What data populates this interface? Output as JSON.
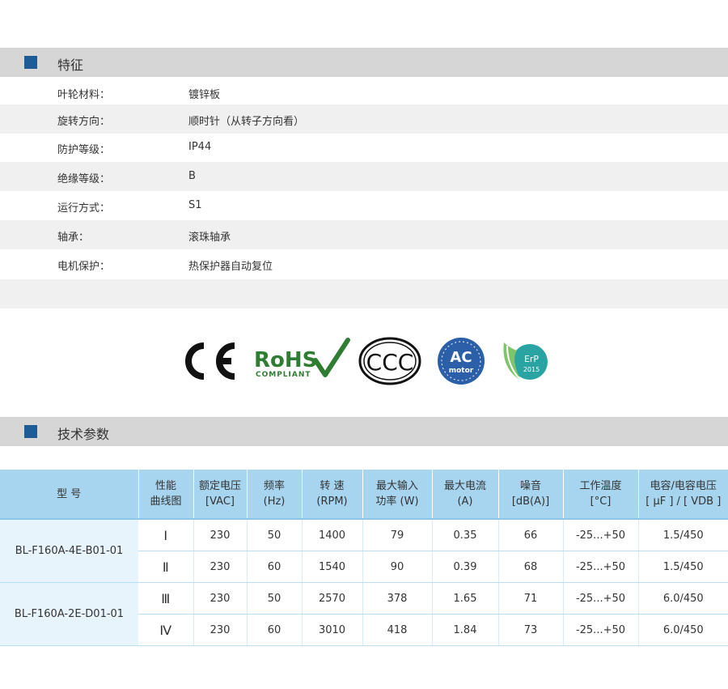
{
  "features": {
    "title": "特征",
    "rows": [
      {
        "label": "叶轮材料：",
        "value": "镀锌板"
      },
      {
        "label": "旋转方向：",
        "value": "顺时针（从转子方向看）"
      },
      {
        "label": "防护等级：",
        "value": "IP44"
      },
      {
        "label": "绝缘等级：",
        "value": "B"
      },
      {
        "label": "运行方式：",
        "value": "S1"
      },
      {
        "label": "轴承：",
        "value": "滚珠轴承"
      },
      {
        "label": "电机保护：",
        "value": "热保护器自动复位"
      }
    ]
  },
  "certifications": {
    "ce": "CE",
    "rohs_main": "RoHS",
    "rohs_sub": "COMPLIANT",
    "ccc": "CCC",
    "ac_main": "AC",
    "ac_sub": "motor",
    "erp_main": "ErP",
    "erp_year": "2015",
    "colors": {
      "rohs_green": "#2e7d32",
      "ac_blue": "#2b5fa8",
      "erp_teal": "#2aa3a3"
    }
  },
  "specs": {
    "title": "技术参数",
    "headers": [
      [
        "型 号"
      ],
      [
        "性能",
        "曲线图"
      ],
      [
        "额定电压",
        "[VAC]"
      ],
      [
        "频率",
        "(Hz)"
      ],
      [
        "转 速",
        "(RPM)"
      ],
      [
        "最大输入",
        "功率 (W)"
      ],
      [
        "最大电流",
        "(A)"
      ],
      [
        "噪音",
        "[dB(A)]"
      ],
      [
        "工作温度",
        "[°C]"
      ],
      [
        "电容/电容电压",
        "[ µF ] / [ VDB ]"
      ]
    ],
    "models": [
      {
        "name": "BL-F160A-4E-B01-01",
        "rows": [
          {
            "curve": "Ⅰ",
            "voltage": "230",
            "freq": "50",
            "rpm": "1400",
            "power": "79",
            "current": "0.35",
            "noise": "66",
            "temp": "-25...+50",
            "cap": "1.5/450"
          },
          {
            "curve": "Ⅱ",
            "voltage": "230",
            "freq": "60",
            "rpm": "1540",
            "power": "90",
            "current": "0.39",
            "noise": "68",
            "temp": "-25...+50",
            "cap": "1.5/450"
          }
        ]
      },
      {
        "name": "BL-F160A-2E-D01-01",
        "rows": [
          {
            "curve": "Ⅲ",
            "voltage": "230",
            "freq": "50",
            "rpm": "2570",
            "power": "378",
            "current": "1.65",
            "noise": "71",
            "temp": "-25...+50",
            "cap": "6.0/450"
          },
          {
            "curve": "Ⅳ",
            "voltage": "230",
            "freq": "60",
            "rpm": "3010",
            "power": "418",
            "current": "1.84",
            "noise": "73",
            "temp": "-25...+50",
            "cap": "6.0/450"
          }
        ]
      }
    ]
  }
}
